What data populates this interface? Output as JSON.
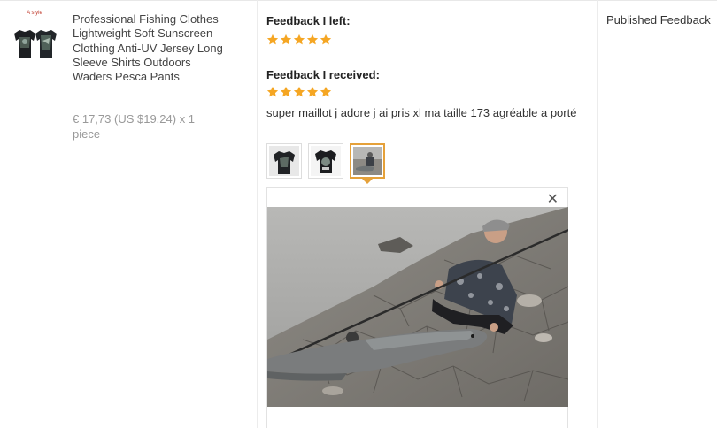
{
  "product": {
    "thumb_caption": "A style",
    "title": "Professional Fishing Clothes Lightweight Soft Sunscreen Clothing Anti-UV Jersey Long Sleeve Shirts Outdoors Waders Pesca Pants",
    "price": "€ 17,73 (US $19.24) x 1 piece"
  },
  "feedback": {
    "left_heading": "Feedback I left:",
    "left_rating": 5,
    "received_heading": "Feedback I received:",
    "received_rating": 5,
    "comment": "super maillot j adore j ai pris xl ma taille 173 agréable a porté",
    "photos": [
      {
        "name": "photo-1",
        "active": false
      },
      {
        "name": "photo-2",
        "active": false
      },
      {
        "name": "photo-3",
        "active": true
      }
    ],
    "close_symbol": "✕"
  },
  "published": {
    "heading": "Published Feedback"
  },
  "colors": {
    "star": "#f5a623",
    "active_border": "#e5a13a",
    "text": "#333333",
    "muted": "#999999"
  }
}
